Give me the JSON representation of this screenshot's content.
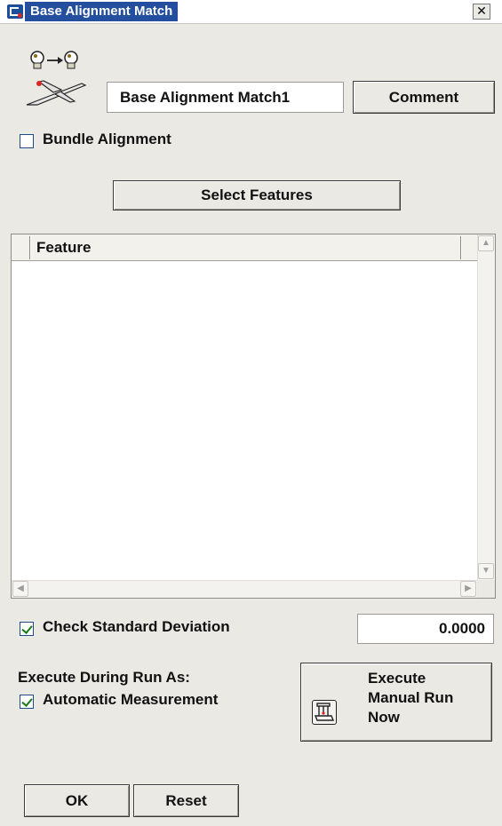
{
  "window": {
    "title": "Base Alignment Match",
    "close_glyph": "✕"
  },
  "header": {
    "icon": "alignment-airplane-icon",
    "name_value": "Base Alignment Match1",
    "comment_label": "Comment"
  },
  "bundle": {
    "label": "Bundle Alignment",
    "checked": false
  },
  "select_features_label": "Select Features",
  "feature_list": {
    "columns": [
      "Feature"
    ],
    "rows": []
  },
  "std_dev": {
    "label": "Check Standard Deviation",
    "checked": true,
    "value": "0.0000"
  },
  "execute": {
    "heading": "Execute During Run As:",
    "auto_label": "Automatic Measurement",
    "auto_checked": true,
    "manual_line1": "Execute",
    "manual_line2": "Manual Run",
    "manual_line3": "Now",
    "manual_icon": "cmm-machine-icon"
  },
  "footer": {
    "ok_label": "OK",
    "reset_label": "Reset"
  },
  "colors": {
    "title_highlight": "#244f9e",
    "dialog_bg": "#ebe9e4",
    "check_green": "#1a7a1a"
  }
}
